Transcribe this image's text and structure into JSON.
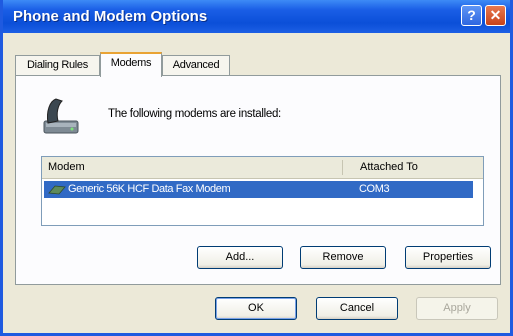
{
  "window": {
    "title": "Phone and Modem Options"
  },
  "titlebar_buttons": {
    "help": "?",
    "close": "✕"
  },
  "tabs": [
    {
      "label": "Dialing Rules",
      "active": false
    },
    {
      "label": "Modems",
      "active": true
    },
    {
      "label": "Advanced",
      "active": false
    }
  ],
  "panel": {
    "intro": "The following modems are installed:",
    "icon": "phone-modem-icon",
    "columns": [
      "Modem",
      "Attached To"
    ],
    "rows": [
      {
        "modem": "Generic 56K HCF Data Fax Modem",
        "attached_to": "COM3",
        "selected": true
      }
    ],
    "buttons": {
      "add": "Add...",
      "remove": "Remove",
      "properties": "Properties"
    }
  },
  "footer": {
    "ok": "OK",
    "cancel": "Cancel",
    "apply": "Apply"
  },
  "colors": {
    "titlebar": "#0b4fd8",
    "selection": "#316ac5",
    "dialog_bg": "#ece9d8"
  }
}
